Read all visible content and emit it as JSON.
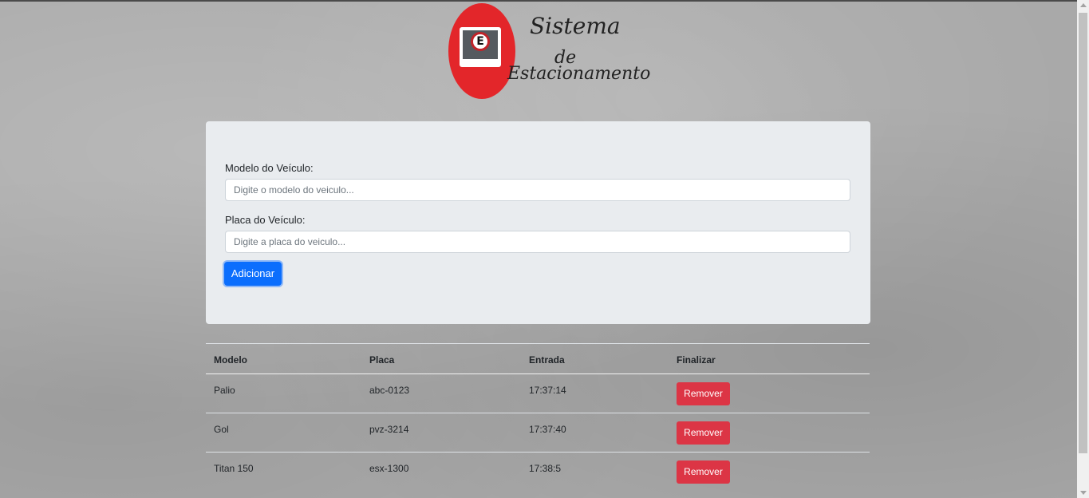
{
  "logo": {
    "badge_letter": "E",
    "line1": "Sistema",
    "line2": "de",
    "line3": "Estacionamento",
    "brand_color": "#e3262a"
  },
  "form": {
    "model_label": "Modelo do Veículo:",
    "model_placeholder": "Digite o modelo do veiculo...",
    "plate_label": "Placa do Veículo:",
    "plate_placeholder": "Digite a placa do veiculo...",
    "add_button": "Adicionar",
    "button_color": "#0b6efd"
  },
  "table": {
    "headers": [
      "Modelo",
      "Placa",
      "Entrada",
      "Finalizar"
    ],
    "rows": [
      {
        "modelo": "Palio",
        "placa": "abc-0123",
        "entrada": "17:37:14",
        "action": "Remover"
      },
      {
        "modelo": "Gol",
        "placa": "pvz-3214",
        "entrada": "17:37:40",
        "action": "Remover"
      },
      {
        "modelo": "Titan 150",
        "placa": "esx-1300",
        "entrada": "17:38:5",
        "action": "Remover"
      }
    ],
    "remove_color": "#dc3545"
  }
}
